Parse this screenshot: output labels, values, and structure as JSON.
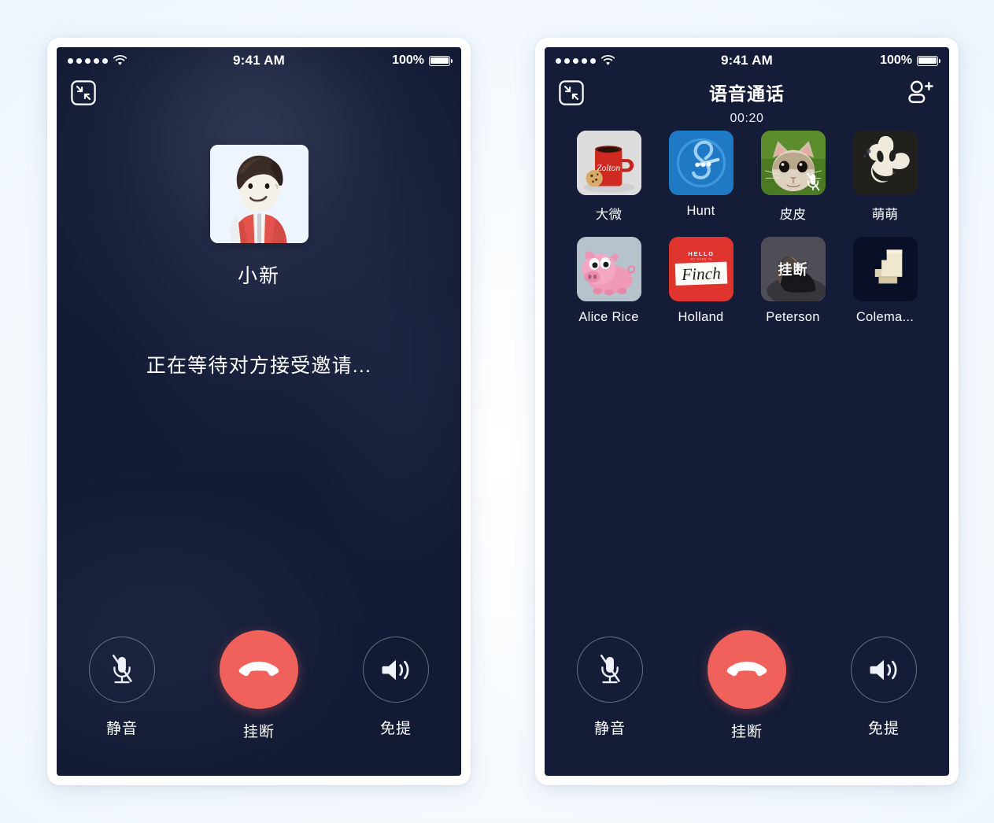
{
  "theme": {
    "page_bg": "#fbfdff",
    "screen_bg": "#141c38",
    "accent_hangup": "#f0615c",
    "text_primary": "#ffffff"
  },
  "status_bar": {
    "signal_dots": 5,
    "wifi": "wifi-icon",
    "time": "9:41 AM",
    "battery_percent": "100%"
  },
  "left_phone": {
    "nav": {
      "minimize_icon": "minimize-icon"
    },
    "callee": {
      "name": "小新",
      "avatar": "cartoon-boy-red-jacket"
    },
    "status_text": "正在等待对方接受邀请...",
    "controls": [
      {
        "id": "mute",
        "label": "静音",
        "icon": "mic-muted-icon"
      },
      {
        "id": "hangup",
        "label": "挂断",
        "icon": "phone-hangup-icon"
      },
      {
        "id": "speaker",
        "label": "免提",
        "icon": "speaker-icon"
      }
    ]
  },
  "right_phone": {
    "nav": {
      "minimize_icon": "minimize-icon",
      "title": "语音通话",
      "duration": "00:20",
      "add_member_icon": "add-person-icon"
    },
    "members": [
      {
        "name": "大微",
        "avatar": "red-mug-zolton",
        "muted": false,
        "caption": ""
      },
      {
        "name": "Hunt",
        "avatar": "blue-b-monogram",
        "muted": false,
        "caption": ""
      },
      {
        "name": "皮皮",
        "avatar": "cat-photo",
        "muted": true,
        "caption": ""
      },
      {
        "name": "萌萌",
        "avatar": "cartoon-face-mascot",
        "muted": false,
        "caption": ""
      },
      {
        "name": "Alice Rice",
        "avatar": "pink-pig",
        "muted": false,
        "caption": ""
      },
      {
        "name": "Holland",
        "avatar": "hello-finch-nametag",
        "muted": false,
        "caption": ""
      },
      {
        "name": "Peterson",
        "avatar": "dark-photo",
        "muted": false,
        "caption": "挂断"
      },
      {
        "name": "Colema...",
        "avatar": "cream-stairs-shape",
        "muted": false,
        "caption": ""
      }
    ],
    "controls": [
      {
        "id": "mute",
        "label": "静音",
        "icon": "mic-muted-icon"
      },
      {
        "id": "hangup",
        "label": "挂断",
        "icon": "phone-hangup-icon"
      },
      {
        "id": "speaker",
        "label": "免提",
        "icon": "speaker-icon"
      }
    ]
  }
}
